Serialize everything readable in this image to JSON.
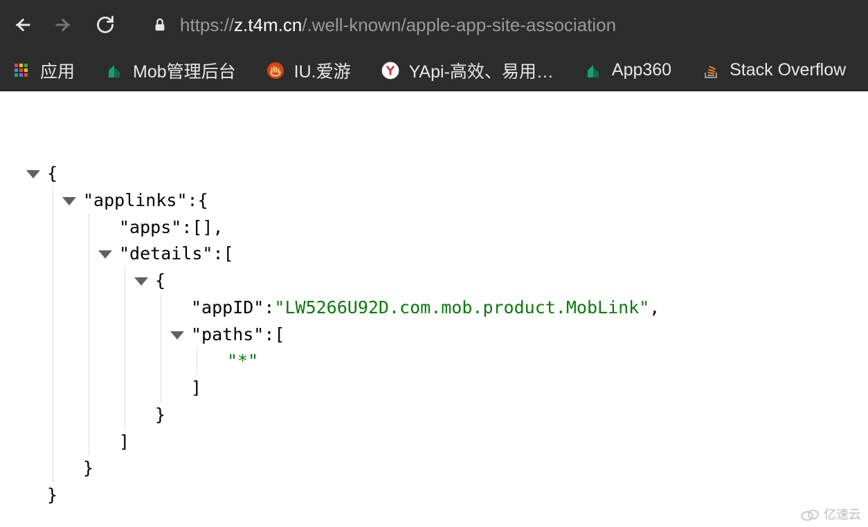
{
  "toolbar": {
    "url_prefix": "https://",
    "url_host": "z.t4m.cn",
    "url_path": "/.well-known/apple-app-site-association"
  },
  "bookmarks": {
    "apps_label": "应用",
    "items": [
      {
        "label": "Mob管理后台",
        "icon": "building-green"
      },
      {
        "label": "IU.爱游",
        "icon": "hand-orange"
      },
      {
        "label": "YApi-高效、易用…",
        "icon": "y-circle"
      },
      {
        "label": "App360",
        "icon": "building-green"
      },
      {
        "label": "Stack Overflow",
        "icon": "stack-orange"
      }
    ]
  },
  "json": {
    "open_brace": "{",
    "close_brace": "}",
    "open_bracket": "[",
    "close_bracket": "]",
    "comma": ",",
    "colon": ": ",
    "applinks_key": "\"applinks\"",
    "apps_key": "\"apps\"",
    "apps_value": "[]",
    "details_key": "\"details\"",
    "appID_key": "\"appID\"",
    "appID_value": "\"LW5266U92D.com.mob.product.MobLink\"",
    "paths_key": "\"paths\"",
    "paths_value": "\"*\""
  },
  "watermark": "亿速云"
}
